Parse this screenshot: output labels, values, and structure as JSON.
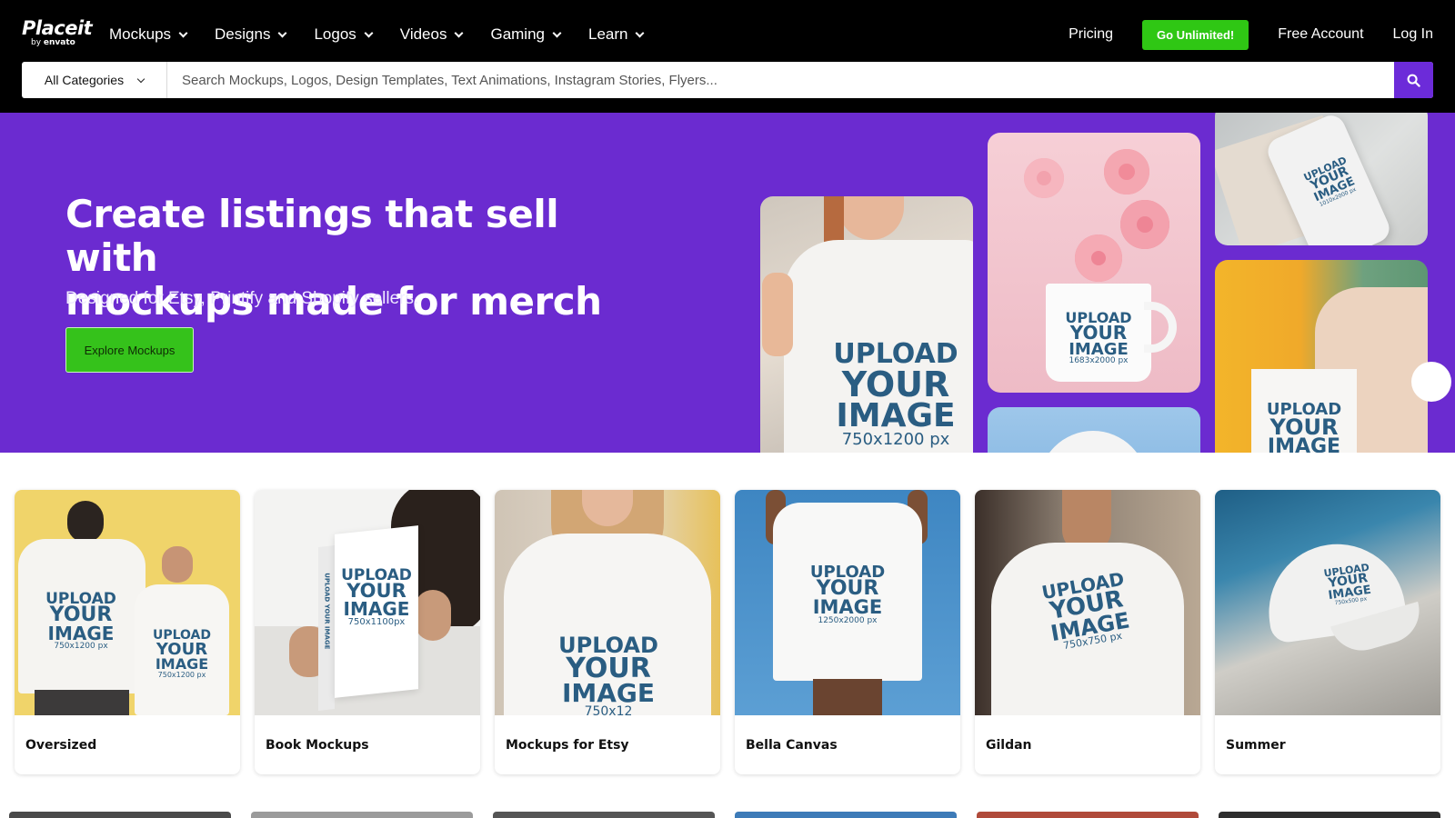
{
  "header": {
    "logo_main": "Placeit",
    "logo_by": "by",
    "logo_brand": "envato",
    "nav": [
      "Mockups",
      "Designs",
      "Logos",
      "Videos",
      "Gaming",
      "Learn"
    ],
    "pricing": "Pricing",
    "go_unlimited": "Go Unlimited!",
    "free_account": "Free Account",
    "login": "Log In"
  },
  "search": {
    "category": "All Categories",
    "placeholder": "Search Mockups, Logos, Design Templates, Text Animations, Instagram Stories, Flyers..."
  },
  "hero": {
    "title_line1": "Create listings that sell with",
    "title_line2": "mockups made for merch",
    "subtitle": "Designed for Etsy, Printify and Shopify sellers.",
    "cta": "Explore Mockups",
    "tiles": {
      "tshirt": {
        "l1": "UPLOAD",
        "l2": "YOUR",
        "l3": "IMAGE",
        "size": "750x1200 px"
      },
      "mug": {
        "l1": "UPLOAD",
        "l2": "YOUR",
        "l3": "IMAGE",
        "size": "1683x2000 px"
      },
      "phone": {
        "l1": "UPLOAD",
        "l2": "YOUR",
        "l3": "IMAGE",
        "size": "1010x2000 px"
      },
      "tote": {
        "l1": "UPLOAD",
        "l2": "YOUR",
        "l3": "IMAGE"
      }
    }
  },
  "categories": [
    {
      "label": "Oversized",
      "upload": "UPLOAD",
      "your": "YOUR",
      "image": "IMAGE",
      "size": "750x1200 px"
    },
    {
      "label": "Book Mockups",
      "upload": "UPLOAD",
      "your": "YOUR",
      "image": "IMAGE",
      "size": "750x1100px",
      "spine": "UPLOAD YOUR IMAGE"
    },
    {
      "label": "Mockups for Etsy",
      "upload": "UPLOAD",
      "your": "YOUR",
      "image": "IMAGE",
      "size": "750x12"
    },
    {
      "label": "Bella Canvas",
      "upload": "UPLOAD",
      "your": "YOUR",
      "image": "IMAGE",
      "size": "1250x2000 px"
    },
    {
      "label": "Gildan",
      "upload": "UPLOAD",
      "your": "YOUR",
      "image": "IMAGE",
      "size": "750x750 px"
    },
    {
      "label": "Summer",
      "upload": "UPLOAD",
      "your": "YOUR",
      "image": "IMAGE",
      "size": "750x500 px"
    }
  ],
  "colors": {
    "header_bg": "#000000",
    "accent_purple": "#6b2bd0",
    "cta_green": "#2fc714"
  }
}
